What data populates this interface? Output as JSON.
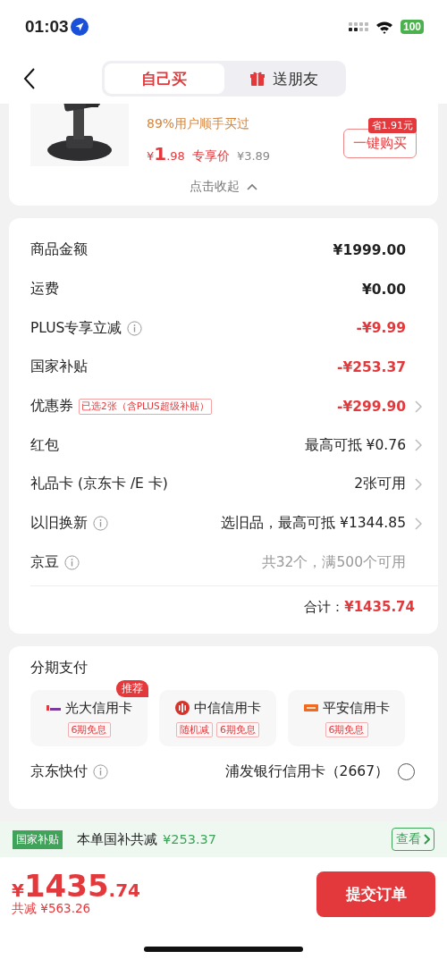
{
  "status_bar": {
    "time": "01:03",
    "battery": "100"
  },
  "header": {
    "tabs": [
      {
        "label": "自己买",
        "selected": true,
        "gift_icon": false
      },
      {
        "label": "送朋友",
        "selected": false,
        "gift_icon": true
      }
    ]
  },
  "product": {
    "social_proof": "89%用户顺手买过",
    "price_symbol": "¥",
    "price_int": "1",
    "price_dec": ".98",
    "price_label": "专享价",
    "original_price": "¥3.89",
    "save_badge": "省1.91元",
    "buy_button": "一键购买",
    "collapse": "点击收起"
  },
  "summary": {
    "rows": [
      {
        "label": "商品金额",
        "info": false,
        "value": "¥1999.00",
        "kind": "amount",
        "chevron": false
      },
      {
        "label": "运费",
        "info": false,
        "value": "¥0.00",
        "kind": "amount",
        "chevron": false
      },
      {
        "label": "PLUS专享立减",
        "info": true,
        "value": "-¥9.99",
        "kind": "discount",
        "chevron": false
      },
      {
        "label": "国家补贴",
        "info": false,
        "value": "-¥253.37",
        "kind": "discount",
        "chevron": false
      },
      {
        "label": "优惠券",
        "info": false,
        "tag": "已选2张（含PLUS超级补贴）",
        "value": "-¥299.90",
        "kind": "discount",
        "chevron": true
      },
      {
        "label": "红包",
        "info": false,
        "value": "最高可抵 ¥0.76",
        "kind": "option",
        "chevron": true
      },
      {
        "label": "礼品卡 (京东卡 /E 卡)",
        "info": false,
        "value": "2张可用",
        "kind": "option",
        "chevron": true
      },
      {
        "label": "以旧换新",
        "info": true,
        "value": "选旧品，最高可抵 ¥1344.85",
        "kind": "option",
        "chevron": true
      },
      {
        "label": "京豆",
        "info": true,
        "value": "共32个，满500个可用",
        "kind": "muted",
        "chevron": false
      }
    ],
    "total_label": "合计：",
    "total_value": "¥1435.74"
  },
  "payment": {
    "title": "分期支付",
    "cards": [
      {
        "name": "光大信用卡",
        "kind": "everbright",
        "badge": "推荐",
        "tags": [
          "6期免息"
        ]
      },
      {
        "name": "中信信用卡",
        "kind": "citic",
        "tags": [
          "随机减",
          "6期免息"
        ]
      },
      {
        "name": "平安信用卡",
        "kind": "pingan",
        "tags": [
          "6期免息"
        ]
      }
    ],
    "quick_pay": {
      "label": "京东快付",
      "info": true,
      "card": "浦发银行信用卡（2667）",
      "selected": false
    }
  },
  "subsidy_banner": {
    "tag": "国家补贴",
    "text": "本单国补共减",
    "amount": "¥253.37",
    "button": "查看"
  },
  "footer": {
    "symbol": "¥",
    "int": "1435",
    "dec": ".74",
    "saved": "共减 ¥563.26",
    "submit": "提交订单"
  }
}
